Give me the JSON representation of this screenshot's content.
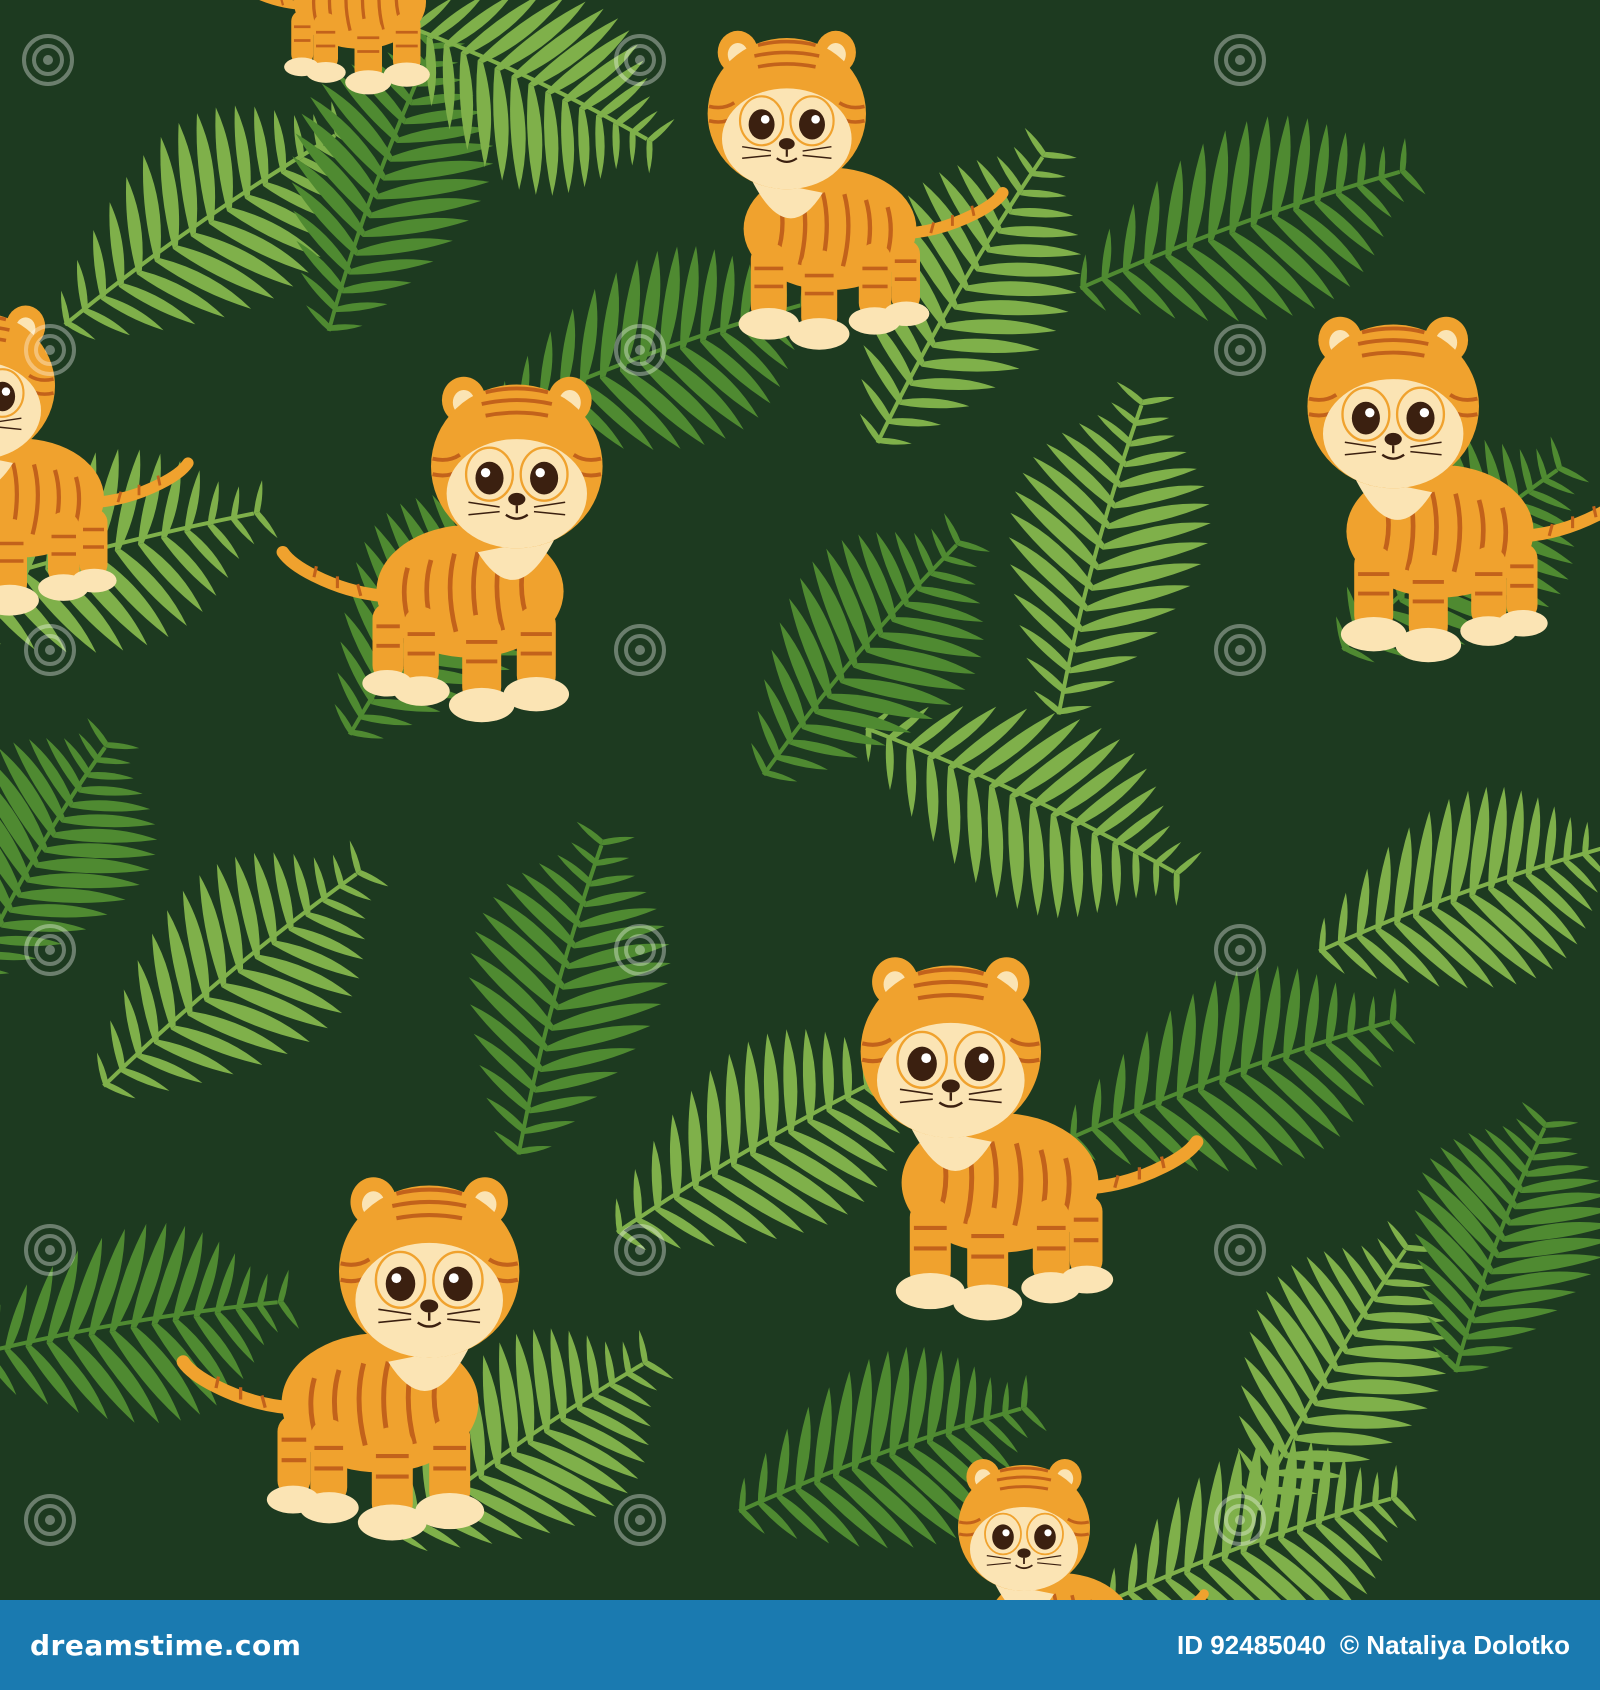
{
  "colors": {
    "background": "#1d3a20",
    "palm_light": "#7fb04a",
    "palm_dark": "#4f8a31",
    "tiger_orange": "#f0a22e",
    "tiger_stripe": "#c2621b",
    "tiger_cream": "#fbe4b4",
    "eye": "#3b2010",
    "bar": "#1a7ab0",
    "watermark": "#ffffff"
  },
  "icons": {
    "watermark": "dreamstime-spiral-icon",
    "subject": "tiger-cub-icon",
    "foliage": "palm-leaf-icon"
  },
  "watermark_text": "dreamstime",
  "bottom_bar": {
    "site": "dreamstime.com",
    "id_text": "ID 92485040",
    "copyright": "© Nataliya Dolotko"
  }
}
